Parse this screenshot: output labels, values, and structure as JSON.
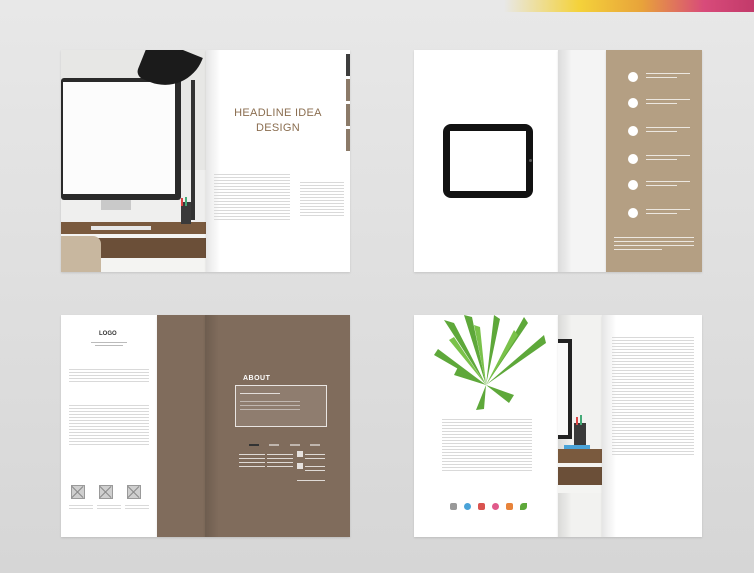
{
  "spread1": {
    "headline_line1": "HEADLINE IDEA",
    "headline_line2": "DESIGN"
  },
  "spread3": {
    "logo_text": "LOGO",
    "brand_text": "ABOUT"
  },
  "colors": {
    "tan": "#b49f83",
    "brown": "#806c5c",
    "accent_brown": "#8a6d4f"
  },
  "icons": [
    "laptop-icon",
    "wifi-icon",
    "mail-icon",
    "heart-icon",
    "person-icon",
    "leaf-icon"
  ]
}
